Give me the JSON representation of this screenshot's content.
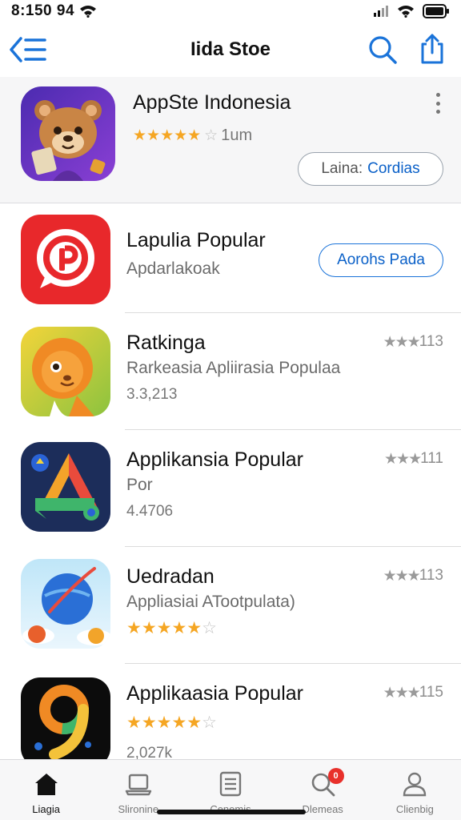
{
  "status_bar": {
    "time": "8:150 94"
  },
  "nav": {
    "title": "Iida Stoe"
  },
  "featured": {
    "title": "AppSte Indonesia",
    "rating": 4.5,
    "stars": "★★★★★",
    "star_empty": "☆",
    "rating_count": "1um",
    "button_prefix": "Laina:",
    "button_label": "Cordias"
  },
  "apps": [
    {
      "title": "Lapulia Popular",
      "subtitle": "Apdarlakoak",
      "button": "Aorohs Pada",
      "icon": "chat-p-icon"
    },
    {
      "title": "Ratkinga",
      "subtitle": "Rarkeasia Apliirasia Populaa",
      "meta": "3.3,213",
      "rank_stars": "★★★",
      "rank": "113",
      "icon": "lion-icon"
    },
    {
      "title": "Applikansia Popular",
      "subtitle": "Por",
      "meta": "4.4706",
      "rank_stars": "★★★",
      "rank": "111",
      "icon": "triangle-a-icon"
    },
    {
      "title": "Uedradan",
      "subtitle": "Appliasiai ATootpulata)",
      "stars": "★★★★★",
      "star_empty": "☆",
      "rank_stars": "★★★",
      "rank": "113",
      "icon": "planet-icon"
    },
    {
      "title": "Applikaasia Popular",
      "stars": "★★★★★",
      "star_empty": "☆",
      "meta": "2,027k",
      "rank_stars": "★★★",
      "rank": "115",
      "icon": "nine-icon"
    }
  ],
  "tabs": [
    {
      "label": "Liagia",
      "icon": "home-icon",
      "active": true
    },
    {
      "label": "Slironine",
      "icon": "laptop-icon"
    },
    {
      "label": "Cenemis",
      "icon": "document-icon"
    },
    {
      "label": "Dlemeas",
      "icon": "search-icon",
      "badge": "0"
    },
    {
      "label": "Clienbig",
      "icon": "person-icon"
    }
  ],
  "colors": {
    "accent": "#1a73d9",
    "star": "#f5a623",
    "badge": "#e8302b"
  }
}
